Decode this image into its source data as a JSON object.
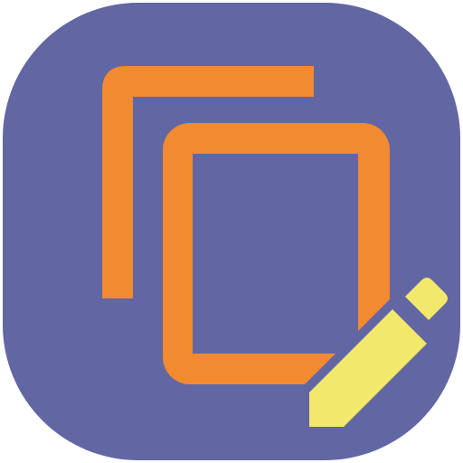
{
  "icon": {
    "background_color": "#6266a3",
    "frame_color": "#f28a30",
    "pencil_color": "#f2e86b",
    "glyphs": [
      "copy-icon",
      "edit-pencil-icon"
    ]
  }
}
